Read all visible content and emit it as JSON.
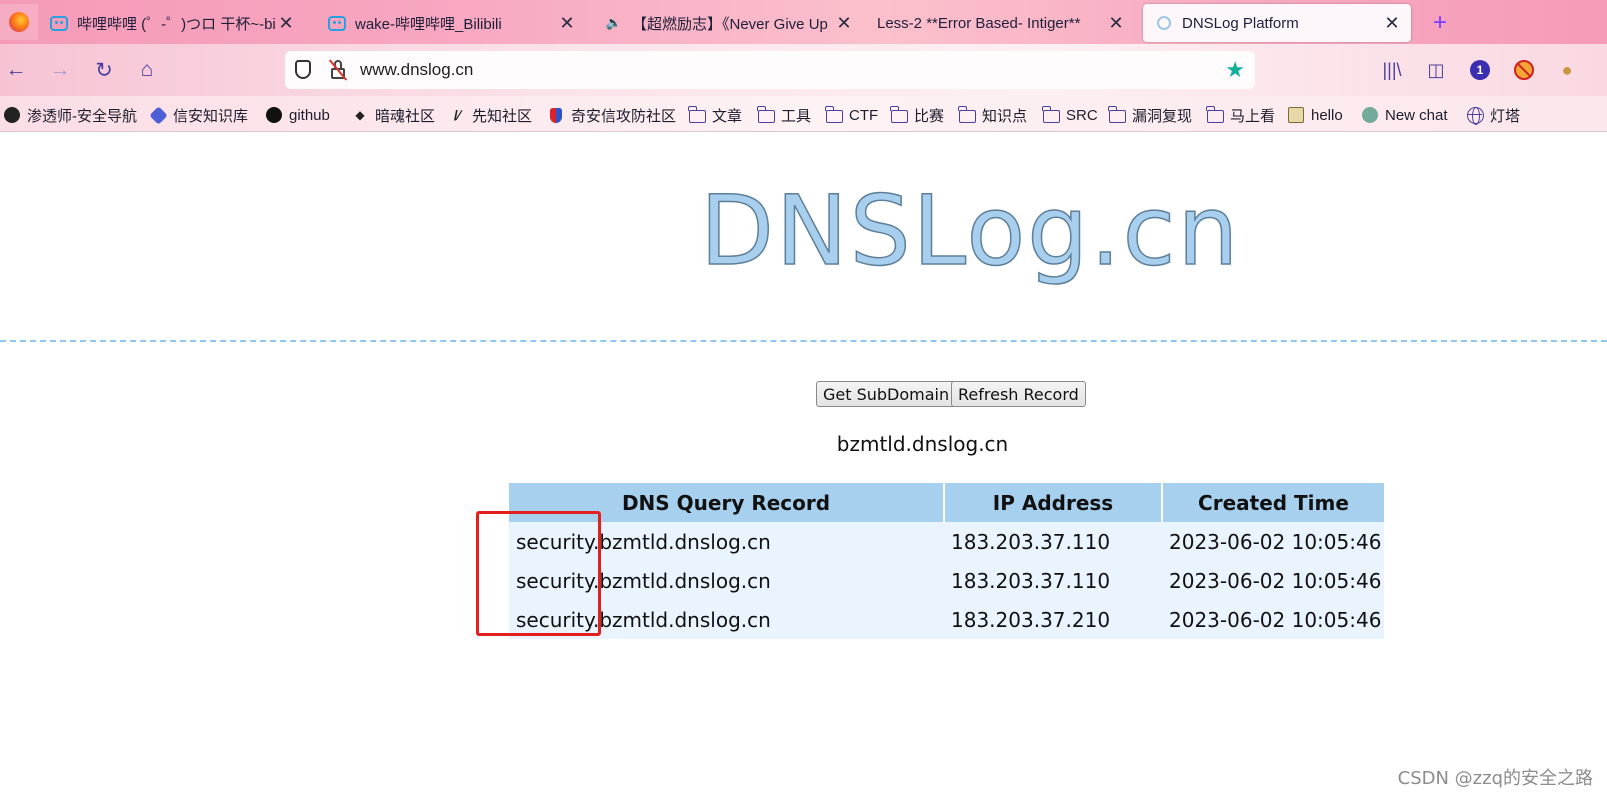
{
  "browser": {
    "tabs": [
      {
        "title": "哔哩哔哩 (゜-゜)つロ 干杯~-bi",
        "icon": "bilibili-icon"
      },
      {
        "title": "wake-哔哩哔哩_Bilibili",
        "icon": "bilibili-icon"
      },
      {
        "title": "【超燃励志】《Never Give Up",
        "icon": "speaker-icon"
      },
      {
        "title": "Less-2 **Error Based- Intiger**",
        "icon": ""
      },
      {
        "title": "DNSLog Platform",
        "icon": "dnslog-favicon",
        "active": true
      }
    ],
    "url": "www.dnslog.cn",
    "toolbar_badge": "1",
    "bookmarks": [
      {
        "label": "渗透师-安全导航",
        "icon": "penetration-icon"
      },
      {
        "label": "信安知识库",
        "icon": "knowledge-base-icon"
      },
      {
        "label": "github",
        "icon": "github-icon"
      },
      {
        "label": "暗魂社区",
        "icon": "anhun-icon"
      },
      {
        "label": "先知社区",
        "icon": "xianzhi-icon"
      },
      {
        "label": "奇安信攻防社区",
        "icon": "qianxin-icon"
      },
      {
        "label": "文章",
        "icon": "folder-icon"
      },
      {
        "label": "工具",
        "icon": "folder-icon"
      },
      {
        "label": "CTF",
        "icon": "folder-icon"
      },
      {
        "label": "比赛",
        "icon": "folder-icon"
      },
      {
        "label": "知识点",
        "icon": "folder-icon"
      },
      {
        "label": "SRC",
        "icon": "folder-icon"
      },
      {
        "label": "漏洞复现",
        "icon": "folder-icon"
      },
      {
        "label": "马上看",
        "icon": "folder-icon"
      },
      {
        "label": "hello",
        "icon": "image-icon"
      },
      {
        "label": "New chat",
        "icon": "chatgpt-icon"
      },
      {
        "label": "灯塔",
        "icon": "globe-icon"
      }
    ]
  },
  "page": {
    "logo_text": "DNSLog.cn",
    "get_subdomain_label": "Get SubDomain",
    "refresh_record_label": "Refresh Record",
    "subdomain": "bzmtld.dnslog.cn",
    "table": {
      "headers": [
        "DNS Query Record",
        "IP Address",
        "Created Time"
      ],
      "rows": [
        [
          "security.bzmtld.dnslog.cn",
          "183.203.37.110",
          "2023-06-02 10:05:46"
        ],
        [
          "security.bzmtld.dnslog.cn",
          "183.203.37.110",
          "2023-06-02 10:05:46"
        ],
        [
          "security.bzmtld.dnslog.cn",
          "183.203.37.210",
          "2023-06-02 10:05:46"
        ]
      ]
    }
  },
  "annotation": {
    "highlight_color": "#e22020"
  },
  "watermark": "CSDN @zzq的安全之路"
}
